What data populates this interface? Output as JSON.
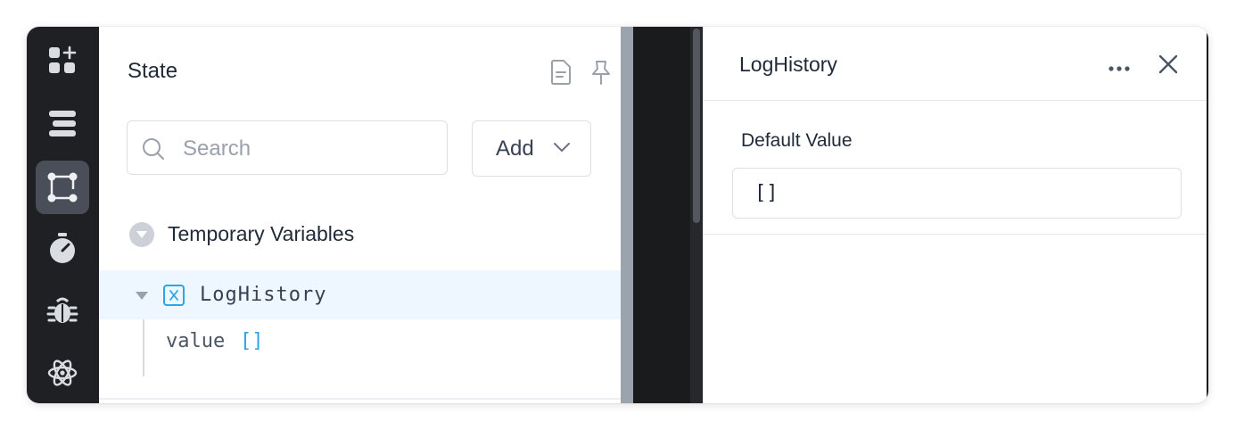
{
  "rail": {
    "items": [
      {
        "icon": "add-component-icon",
        "active": false
      },
      {
        "icon": "list-layers-icon",
        "active": false
      },
      {
        "icon": "state-graph-icon",
        "active": true
      },
      {
        "icon": "stopwatch-icon",
        "active": false
      },
      {
        "icon": "bug-icon",
        "active": false
      },
      {
        "icon": "react-atom-icon",
        "active": false
      }
    ]
  },
  "state_panel": {
    "title": "State",
    "search_placeholder": "Search",
    "add_label": "Add",
    "section_label": "Temporary Variables",
    "variable": {
      "name": "LogHistory",
      "key": "value",
      "value": "[]"
    }
  },
  "inspector": {
    "title": "LogHistory",
    "default_value_label": "Default Value",
    "default_value": "[]"
  },
  "colors": {
    "rail_bg": "#1f2023",
    "rail_active": "#4a4e59",
    "accent": "#2aa5e6",
    "row_highlight": "#eef6ff"
  }
}
